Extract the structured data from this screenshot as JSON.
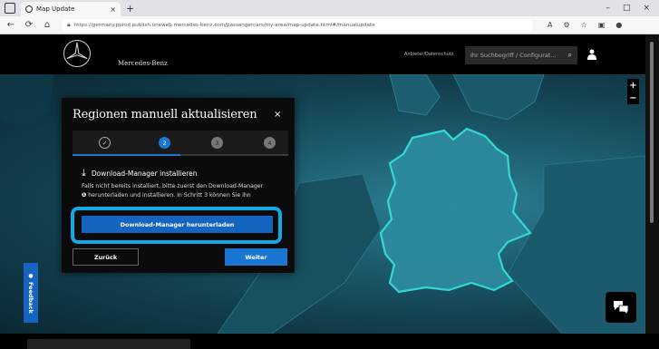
{
  "browser": {
    "tab_title": "Map Update",
    "tab_close": "×",
    "new_tab": "+",
    "window_controls": [
      "–",
      "□",
      "×"
    ],
    "url": "https://germany.pprod.publish.oneweb.mercedes-benz.com/passengercars/my-area/map-update.html#/manualupdate",
    "nav": [
      "←",
      "⟳",
      "⌂"
    ]
  },
  "header": {
    "brand": "Mercedes-Benz",
    "link": "Anbieter/Datenschutz",
    "search_placeholder": "Ihr Suchbegriff / Configurat...",
    "search_icon": "⌕"
  },
  "dialog": {
    "title": "Regionen manuell aktualisieren",
    "close": "×",
    "steps": [
      {
        "label": "✓",
        "state": "done"
      },
      {
        "label": "2",
        "state": "active"
      },
      {
        "label": "3",
        "state": "todo"
      },
      {
        "label": "4",
        "state": "todo"
      }
    ],
    "progress_fraction": 0.5,
    "section_title": "Download-Manager installieren",
    "description_line1": "Falls nicht bereits installiert, bitte zuerst den Download-Manager",
    "description_line2": "herunterladen und installieren. In Schritt 3 können Sie ihn",
    "info_icon": "❶",
    "primary_button": "Download-Manager herunterladen",
    "back_button": "Zurück",
    "next_button": "Weiter"
  },
  "map": {
    "zoom_in": "+",
    "zoom_out": "−"
  },
  "feedback_label": "Feedback",
  "colors": {
    "accent": "#1976d2",
    "highlight": "#14a8e6",
    "map_border": "#34e0d8"
  }
}
